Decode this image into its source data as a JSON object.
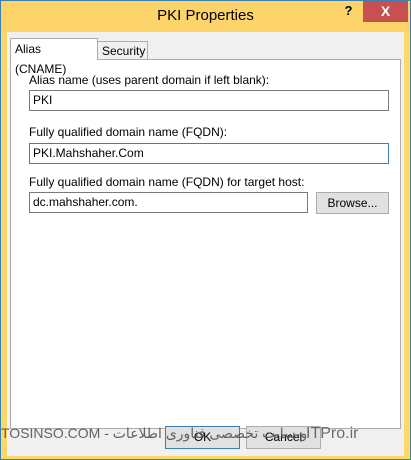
{
  "window": {
    "title": "PKI Properties"
  },
  "titlebar": {
    "help_label": "?",
    "close_label": "X"
  },
  "tabs": [
    {
      "label": "Alias (CNAME)"
    },
    {
      "label": "Security"
    }
  ],
  "form": {
    "alias_label": "Alias name (uses parent domain if left blank):",
    "alias_value": "PKI",
    "fqdn_label": "Fully qualified domain name (FQDN):",
    "fqdn_value": "PKI.Mahshaher.Com",
    "target_label": "Fully qualified domain name (FQDN) for target host:",
    "target_value": "dc.mahshaher.com.",
    "browse_label": "Browse..."
  },
  "buttons": {
    "ok_label": "OK",
    "cancel_label": "Cancel"
  },
  "watermark": {
    "left_text": "TOSINSO.COM - وبسایت تخصصی فناوری اطلاعات",
    "right_text": "ITPro.ir"
  }
}
